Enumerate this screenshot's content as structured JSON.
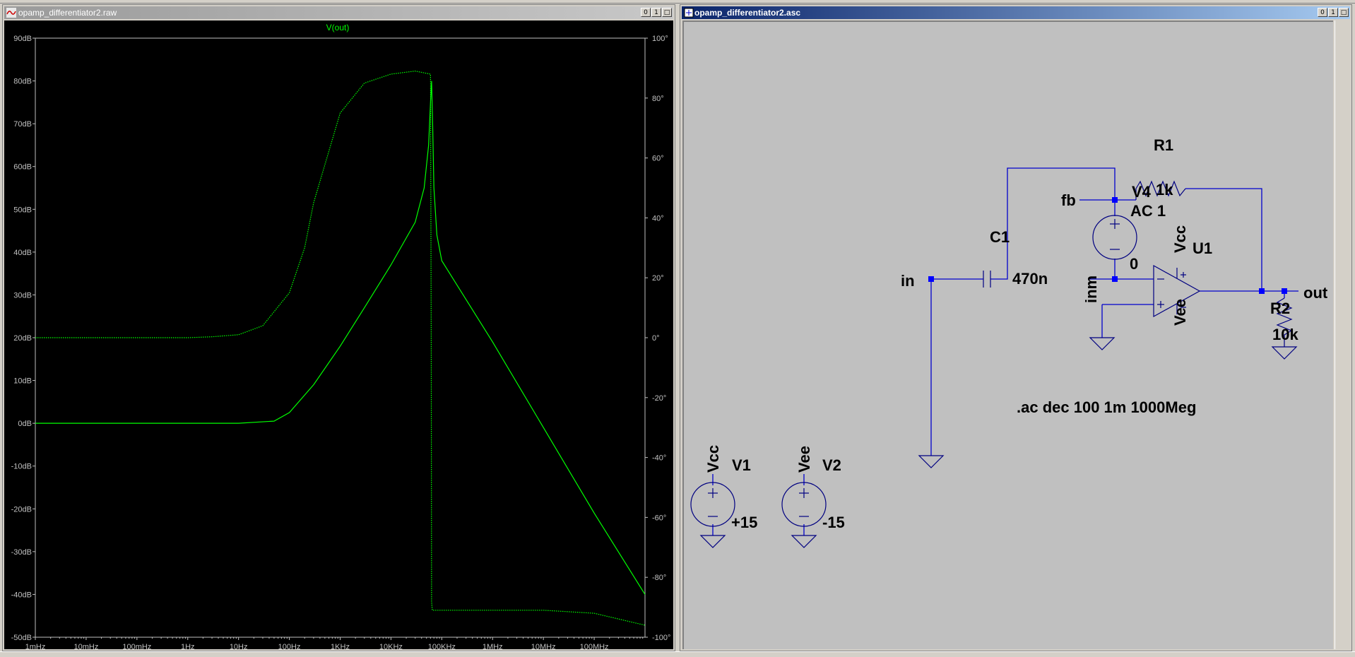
{
  "windows": {
    "waveform": {
      "title": "opamp_differentiator2.raw",
      "buttons": {
        "minimize": "0",
        "restore": "1",
        "close": "□"
      }
    },
    "schematic": {
      "title": "opamp_differentiator2.asc",
      "buttons": {
        "minimize": "0",
        "restore": "1",
        "close": "□"
      }
    }
  },
  "chart_data": {
    "type": "line",
    "title": "V(out)",
    "x_scale": "log",
    "x_range_hz": [
      0.001,
      1000000000
    ],
    "xticks": [
      "1mHz",
      "10mHz",
      "100mHz",
      "1Hz",
      "10Hz",
      "100Hz",
      "1KHz",
      "10KHz",
      "100KHz",
      "1MHz",
      "10MHz",
      "100MHz"
    ],
    "y_left_range_db": [
      -50,
      90
    ],
    "y_left_ticks": [
      "90dB",
      "80dB",
      "70dB",
      "60dB",
      "50dB",
      "40dB",
      "30dB",
      "20dB",
      "10dB",
      "0dB",
      "-10dB",
      "-20dB",
      "-30dB",
      "-40dB",
      "-50dB"
    ],
    "y_right_range_deg": [
      -100,
      100
    ],
    "y_right_ticks": [
      "100°",
      "80°",
      "60°",
      "40°",
      "20°",
      "0°",
      "-20°",
      "-40°",
      "-60°",
      "-80°",
      "-100°"
    ],
    "grid": false,
    "colors": {
      "background": "#000000",
      "trace": "#00ff00",
      "axis": "#c0c0c0",
      "title": "#00ff00"
    },
    "series": [
      {
        "quantity": "magnitude",
        "units": "dB",
        "line": "solid",
        "points": [
          [
            0.001,
            0
          ],
          [
            1,
            0
          ],
          [
            10,
            0
          ],
          [
            50,
            0.5
          ],
          [
            100,
            2.5
          ],
          [
            300,
            9
          ],
          [
            1000,
            18
          ],
          [
            3000,
            27
          ],
          [
            10000,
            37
          ],
          [
            30000,
            47
          ],
          [
            45000,
            55
          ],
          [
            55000,
            65
          ],
          [
            60000,
            75
          ],
          [
            63000,
            80
          ],
          [
            66000,
            70
          ],
          [
            70000,
            55
          ],
          [
            80000,
            44
          ],
          [
            100000,
            38
          ],
          [
            1000000,
            19
          ],
          [
            10000000,
            -1
          ],
          [
            100000000,
            -21
          ],
          [
            1000000000,
            -40
          ]
        ]
      },
      {
        "quantity": "phase",
        "units": "deg",
        "line": "dotted",
        "points": [
          [
            0.001,
            0
          ],
          [
            1,
            0
          ],
          [
            3,
            0.3
          ],
          [
            10,
            1
          ],
          [
            30,
            4
          ],
          [
            100,
            15
          ],
          [
            200,
            30
          ],
          [
            300,
            45
          ],
          [
            1000,
            75
          ],
          [
            3000,
            85
          ],
          [
            10000,
            88
          ],
          [
            30000,
            89
          ],
          [
            60000,
            88
          ],
          [
            62000,
            0
          ],
          [
            63000,
            -88
          ],
          [
            65000,
            -91
          ],
          [
            100000,
            -91
          ],
          [
            1000000,
            -91
          ],
          [
            10000000,
            -91
          ],
          [
            100000000,
            -92
          ],
          [
            1000000000,
            -96
          ]
        ]
      }
    ]
  },
  "schematic": {
    "nets": {
      "in": "in",
      "fb": "fb",
      "inm": "inm",
      "out": "out",
      "zero": "0",
      "vcc_label": "Vcc",
      "vee_label": "Vee"
    },
    "components": {
      "R1": {
        "name": "R1",
        "value": "1k"
      },
      "R2": {
        "name": "R2",
        "value": "10k"
      },
      "C1": {
        "name": "C1",
        "value": "470n"
      },
      "V4": {
        "name": "V4",
        "value": "AC 1"
      },
      "U1": {
        "name": "U1"
      },
      "V1": {
        "name": "V1",
        "value": "+15"
      },
      "V2": {
        "name": "V2",
        "value": "-15"
      }
    },
    "directive": ".ac dec 100 1m 1000Meg",
    "colors": {
      "background": "#c0c0c0",
      "wire": "#0000cc",
      "junction": "#0000ff",
      "symbol": "#000080",
      "text": "#000000"
    }
  }
}
